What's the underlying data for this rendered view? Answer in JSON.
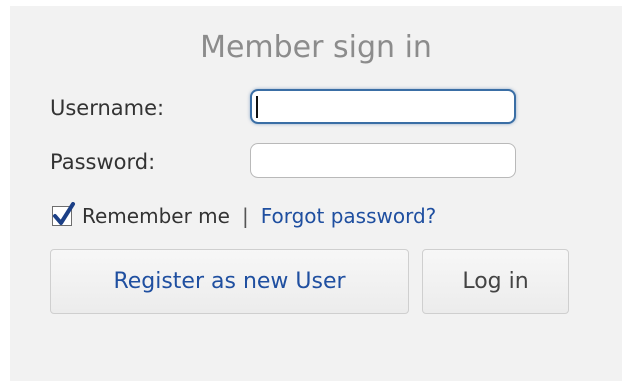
{
  "form": {
    "title": "Member sign in",
    "username_label": "Username:",
    "username_value": "",
    "password_label": "Password:",
    "password_value": "",
    "remember_label": "Remember me",
    "remember_checked": true,
    "separator": "|",
    "forgot_link": "Forgot password?",
    "register_button": "Register as new User",
    "login_button": "Log in"
  },
  "colors": {
    "panel_background": "#f2f2f2",
    "title_text": "#8c8c8c",
    "link_blue": "#1f4fa0",
    "focused_border": "#3a6ea5"
  },
  "icons": {
    "checkbox": "checkmark-icon"
  }
}
